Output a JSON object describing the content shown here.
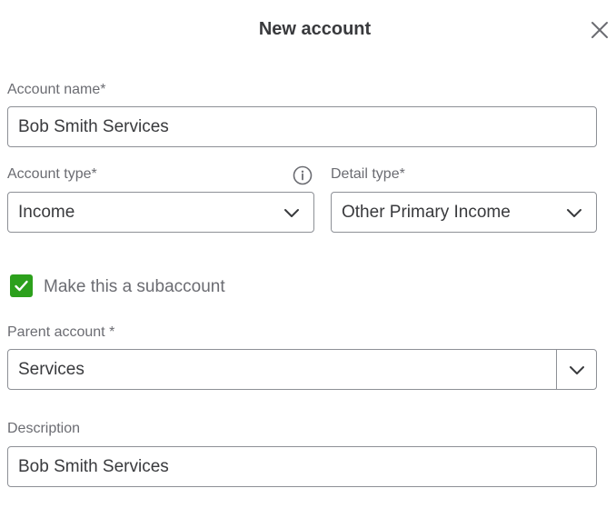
{
  "dialog": {
    "title": "New account"
  },
  "icons": {
    "close": "close-icon",
    "info": "info-icon",
    "chevron": "chevron-down-icon",
    "check": "checkmark-icon"
  },
  "colors": {
    "checkbox_checked": "#2ca01c",
    "border": "#8d9096",
    "label": "#6b6c72",
    "text": "#393a3d"
  },
  "form": {
    "account_name": {
      "label": "Account name*",
      "value": "Bob Smith Services"
    },
    "account_type": {
      "label": "Account type*",
      "selected": "Income"
    },
    "detail_type": {
      "label": "Detail type*",
      "selected": "Other Primary Income"
    },
    "subaccount": {
      "label": "Make this a subaccount",
      "checked": true
    },
    "parent_account": {
      "label": "Parent account *",
      "selected": "Services"
    },
    "description": {
      "label": "Description",
      "value": "Bob Smith Services"
    }
  }
}
